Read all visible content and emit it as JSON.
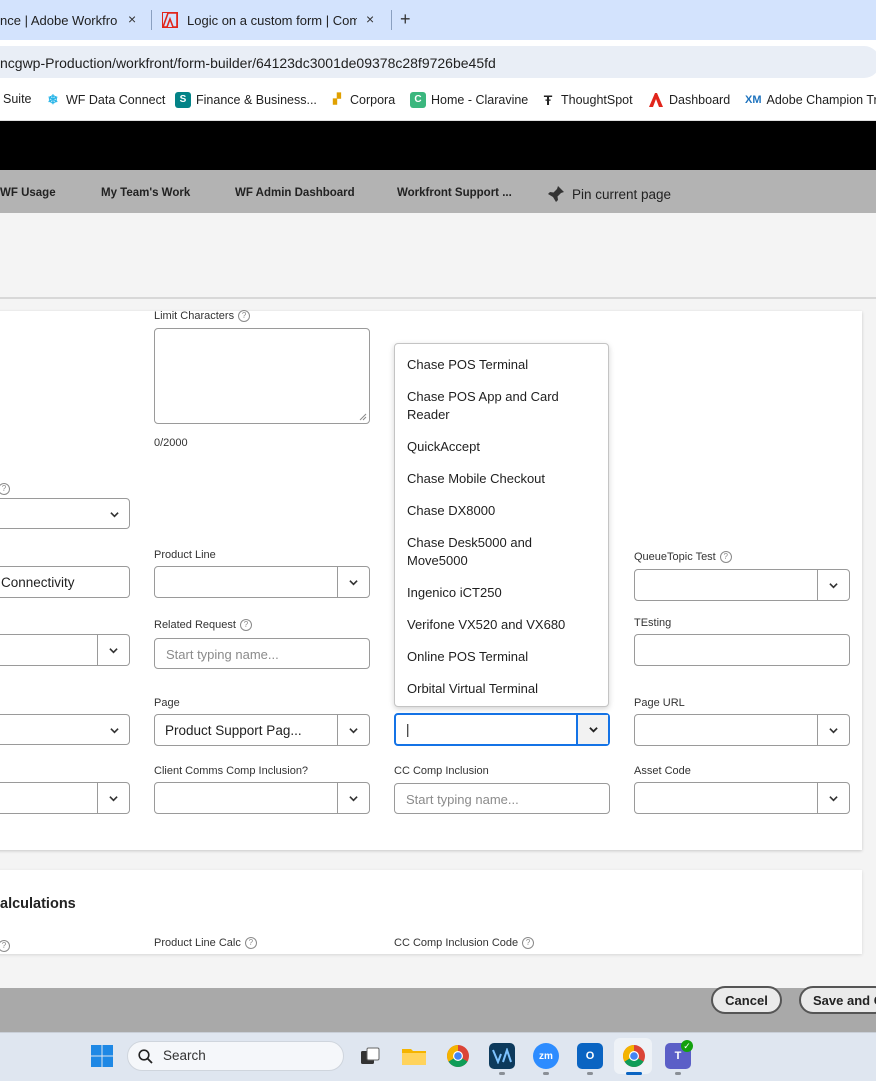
{
  "browser": {
    "tabs": [
      {
        "title": "nce | Adobe Workfron",
        "close": "×"
      },
      {
        "title": "Logic on a custom form | Comm",
        "close": "×"
      }
    ],
    "new_tab": "+",
    "url": "ncgwp-Production/workfront/form-builder/64123dc3001de09378c28f9726be45fd",
    "bookmarks": [
      {
        "label": "Suite",
        "icon": ""
      },
      {
        "label": "WF Data Connect",
        "icon": "snowflake-icon"
      },
      {
        "label": "Finance & Business...",
        "icon": "sharepoint-icon"
      },
      {
        "label": "Corpora",
        "icon": "corpora-icon"
      },
      {
        "label": "Home - Claravine",
        "icon": "claravine-icon"
      },
      {
        "label": "ThoughtSpot",
        "icon": "thoughtspot-icon"
      },
      {
        "label": "Dashboard",
        "icon": "adobe-icon"
      },
      {
        "label": "Adobe Champion Tr",
        "icon": "xm-icon",
        "prefix": "XM"
      }
    ]
  },
  "nav": {
    "links": [
      "WF Usage",
      "My Team's Work",
      "WF Admin Dashboard",
      "Workfront Support ..."
    ],
    "pin_label": "Pin current page"
  },
  "form": {
    "limit_characters": {
      "label": "Limit Characters",
      "counter": "0/2000"
    },
    "left_partial_values": {
      "connectivity": "Connectivity"
    },
    "product_line": {
      "label": "Product Line",
      "value": ""
    },
    "queue_topic_test": {
      "label": "QueueTopic Test",
      "value": ""
    },
    "related_request": {
      "label": "Related Request",
      "placeholder": "Start typing name..."
    },
    "testing": {
      "label": "TEsting",
      "value": ""
    },
    "page": {
      "label": "Page",
      "value": "Product Support Pag..."
    },
    "active_field": {
      "value": "|"
    },
    "page_url": {
      "label": "Page URL",
      "value": ""
    },
    "client_comms": {
      "label": "Client Comms Comp Inclusion?",
      "value": ""
    },
    "cc_comp_inclusion": {
      "label": "CC Comp Inclusion",
      "placeholder": "Start typing name..."
    },
    "asset_code": {
      "label": "Asset Code",
      "value": ""
    }
  },
  "dropdown": {
    "options": [
      "Chase POS Terminal",
      "Chase POS App and Card Reader",
      "QuickAccept",
      "Chase Mobile Checkout",
      "Chase DX8000",
      "Chase Desk5000 and Move5000",
      "Ingenico iCT250",
      "Verifone VX520 and VX680",
      "Online POS Terminal",
      "Orbital Virtual Terminal"
    ]
  },
  "calculations": {
    "title": "alculations",
    "fields": [
      "Product Line Calc",
      "CC Comp Inclusion Code"
    ]
  },
  "footer": {
    "cancel": "Cancel",
    "save": "Save and C"
  },
  "taskbar": {
    "search_label": "Search"
  }
}
